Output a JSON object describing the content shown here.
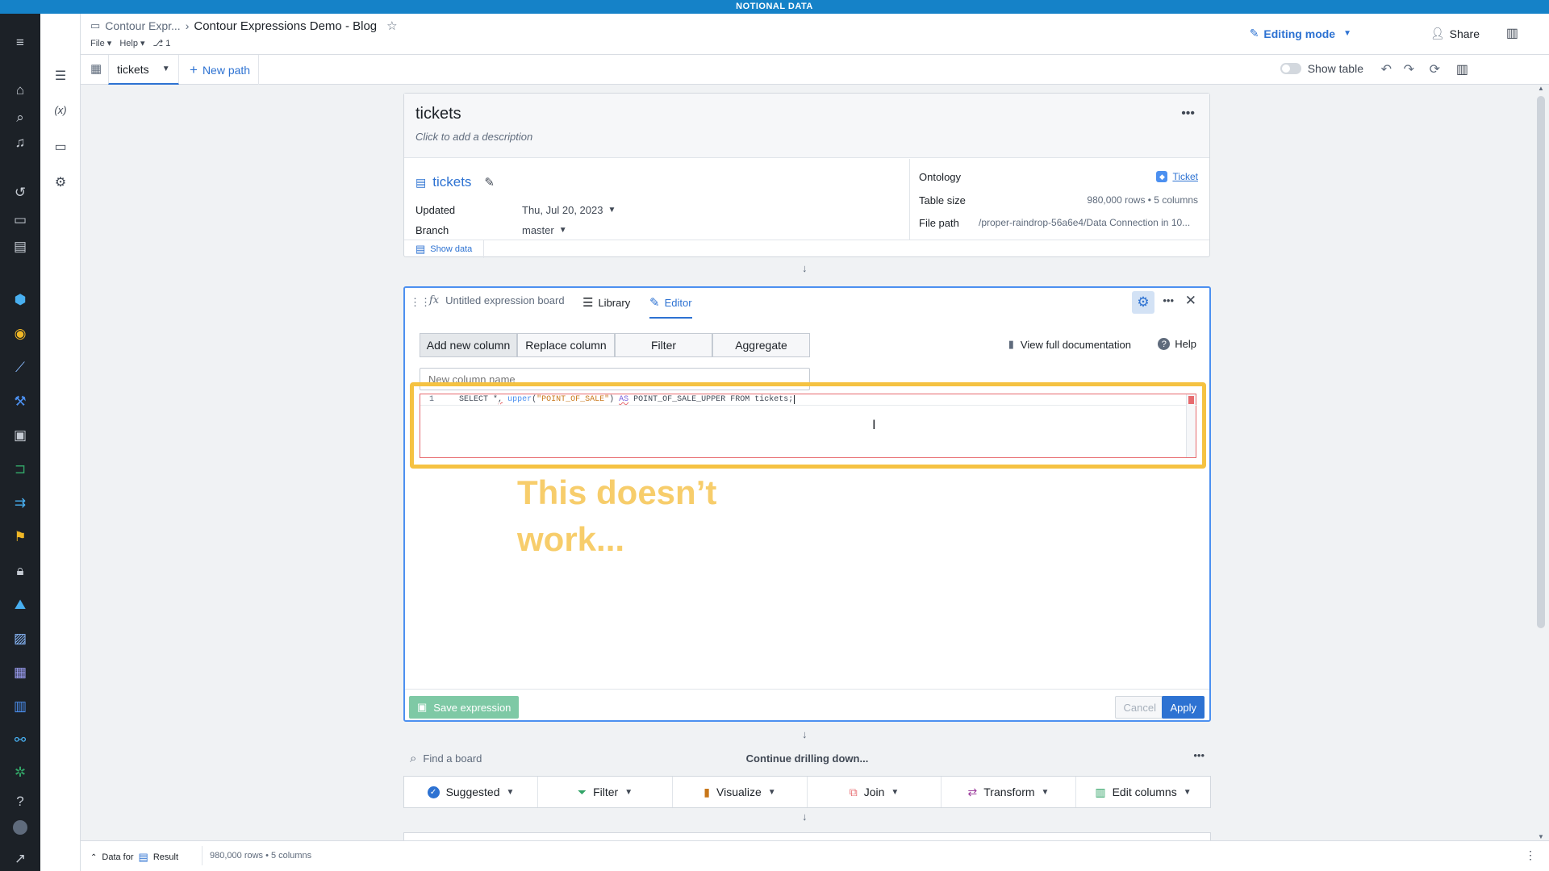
{
  "banner": "NOTIONAL DATA",
  "header": {
    "breadcrumb_parent": "Contour Expr...",
    "title": "Contour Expressions Demo - Blog",
    "menu_file": "File",
    "menu_help": "Help",
    "branch_count": "1",
    "editing_mode": "Editing mode",
    "share": "Share"
  },
  "tabbar": {
    "active_tab": "tickets",
    "new_path": "New path",
    "show_table": "Show table"
  },
  "dataset_card": {
    "title": "tickets",
    "description_placeholder": "Click to add a description",
    "dataset_name": "tickets",
    "updated_label": "Updated",
    "updated_value": "Thu, Jul 20, 2023",
    "branch_label": "Branch",
    "branch_value": "master",
    "ontology_label": "Ontology",
    "ontology_value": "Ticket",
    "table_size_label": "Table size",
    "table_size_value": "980,000 rows • 5 columns",
    "file_path_label": "File path",
    "file_path_value": "/proper-raindrop-56a6e4/Data Connection in 10...",
    "show_data": "Show data"
  },
  "editor_board": {
    "title": "Untitled expression board",
    "tab_library": "Library",
    "tab_editor": "Editor",
    "segments": [
      "Add new column",
      "Replace column",
      "Filter",
      "Aggregate"
    ],
    "view_docs": "View full documentation",
    "help": "Help",
    "column_name_placeholder": "New column name",
    "line_number": "1",
    "code": {
      "kw_select": "SELECT",
      "star": " *",
      "comma": ",",
      "fn": "upper",
      "paren_open": "(",
      "str": "\"POINT_OF_SALE\"",
      "paren_close": ")",
      "kw_as": "AS",
      "rest": "POINT_OF_SALE_UPPER FROM tickets;"
    },
    "annotation": "This doesn’t work...",
    "save_expression": "Save expression",
    "cancel": "Cancel",
    "apply": "Apply"
  },
  "find_board": {
    "placeholder": "Find a board",
    "continue_label": "Continue drilling down...",
    "buttons": [
      "Suggested",
      "Filter",
      "Visualize",
      "Join",
      "Transform",
      "Edit columns"
    ]
  },
  "bottombar": {
    "data_for": "Data for",
    "result": "Result",
    "stats": "980,000 rows • 5 columns"
  },
  "colors": {
    "accent_blue": "#2d72d2",
    "banner_blue": "#1582c8",
    "highlight_yellow": "#f5c242",
    "annotation_yellow": "#f7cd6b",
    "save_green": "#7ec9a5",
    "error_red": "#e76a6e"
  }
}
